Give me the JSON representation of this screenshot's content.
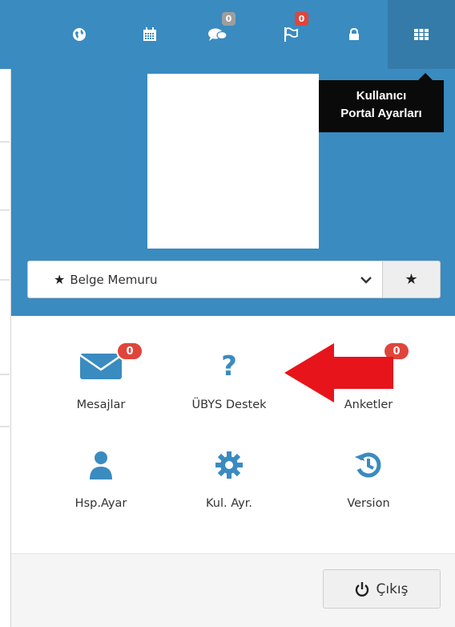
{
  "topbar": {
    "icons": [
      "globe-icon",
      "calendar-icon",
      "comments-icon",
      "flag-icon",
      "lock-icon",
      "grid-icon"
    ],
    "comments_badge": "0",
    "flag_badge": "0"
  },
  "tooltip": {
    "line1": "Kullanıcı",
    "line2": "Portal Ayarları"
  },
  "role": {
    "selected": "Belge Memuru"
  },
  "tiles": [
    {
      "label": "Mesajlar",
      "icon": "envelope-icon",
      "badge": "0"
    },
    {
      "label": "ÜBYS Destek",
      "icon": "question-icon"
    },
    {
      "label": "Anketler",
      "icon": "survey-icon",
      "badge": "0"
    },
    {
      "label": "Hsp.Ayar",
      "icon": "user-icon"
    },
    {
      "label": "Kul. Ayr.",
      "icon": "cog-icon"
    },
    {
      "label": "Version",
      "icon": "history-icon"
    }
  ],
  "footer": {
    "logout_label": "Çıkış"
  },
  "colors": {
    "primary": "#3a8bc0",
    "badge_red": "#e0453a",
    "annotation_arrow": "#e8141b"
  }
}
